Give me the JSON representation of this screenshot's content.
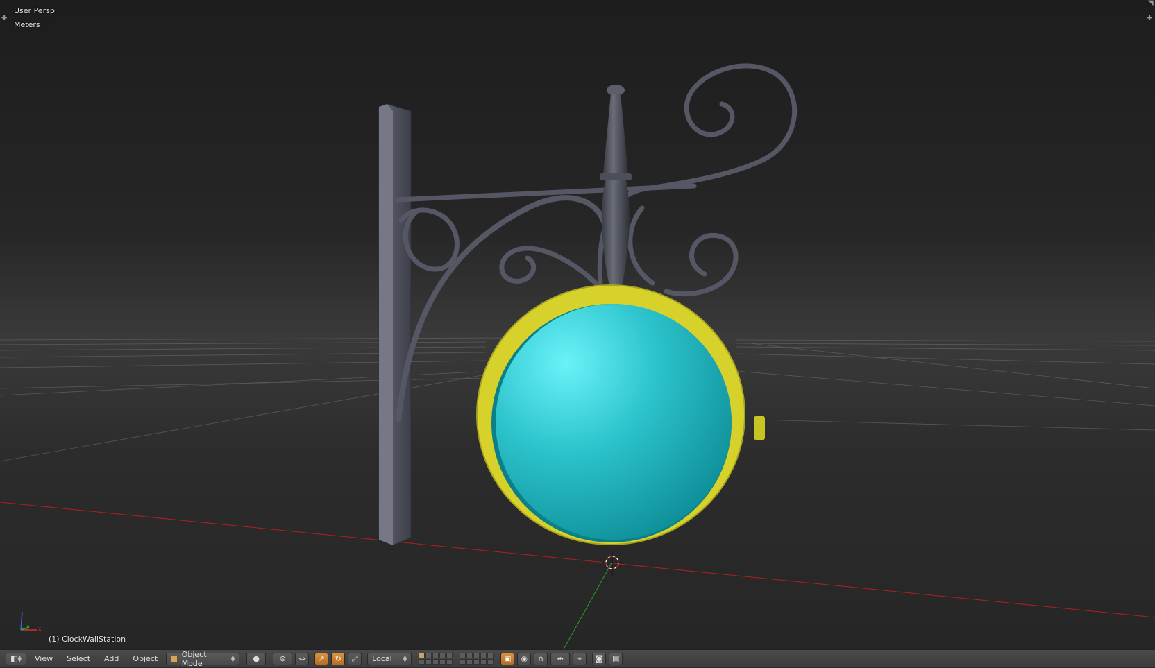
{
  "viewport": {
    "view_name": "User Persp",
    "units": "Meters",
    "active_object": "(1) ClockWallStation"
  },
  "axis_gizmo": {
    "x": "x",
    "y": "y",
    "z": "z"
  },
  "header": {
    "editor_type_icon": "3d-view-icon",
    "menus": {
      "view": "View",
      "select": "Select",
      "add": "Add",
      "object": "Object"
    },
    "mode": {
      "label": "Object Mode",
      "icon": "object-mode-cube-icon"
    },
    "shading_icon": "solid-sphere-icon",
    "pivot_icon": "pivot-point-icon",
    "manipulator_icons": [
      "manipulator-toggle-icon",
      "translate-icon",
      "rotate-icon",
      "scale-icon"
    ],
    "orientation": "Local",
    "layers": {
      "row1_on": [
        0
      ],
      "row2_on": []
    },
    "tools_icons": [
      "lock-icon",
      "proportional-edit-icon",
      "snap-icon",
      "snap-element-icon",
      "render-icon",
      "render-animation-icon"
    ]
  },
  "colors": {
    "clock_rim": "#d6d22b",
    "clock_face": "#1fb9c3",
    "bracket": "#4d505c",
    "x_axis": "#b02020",
    "y_axis": "#2aa02a",
    "active_tool": "#d18a3a"
  }
}
